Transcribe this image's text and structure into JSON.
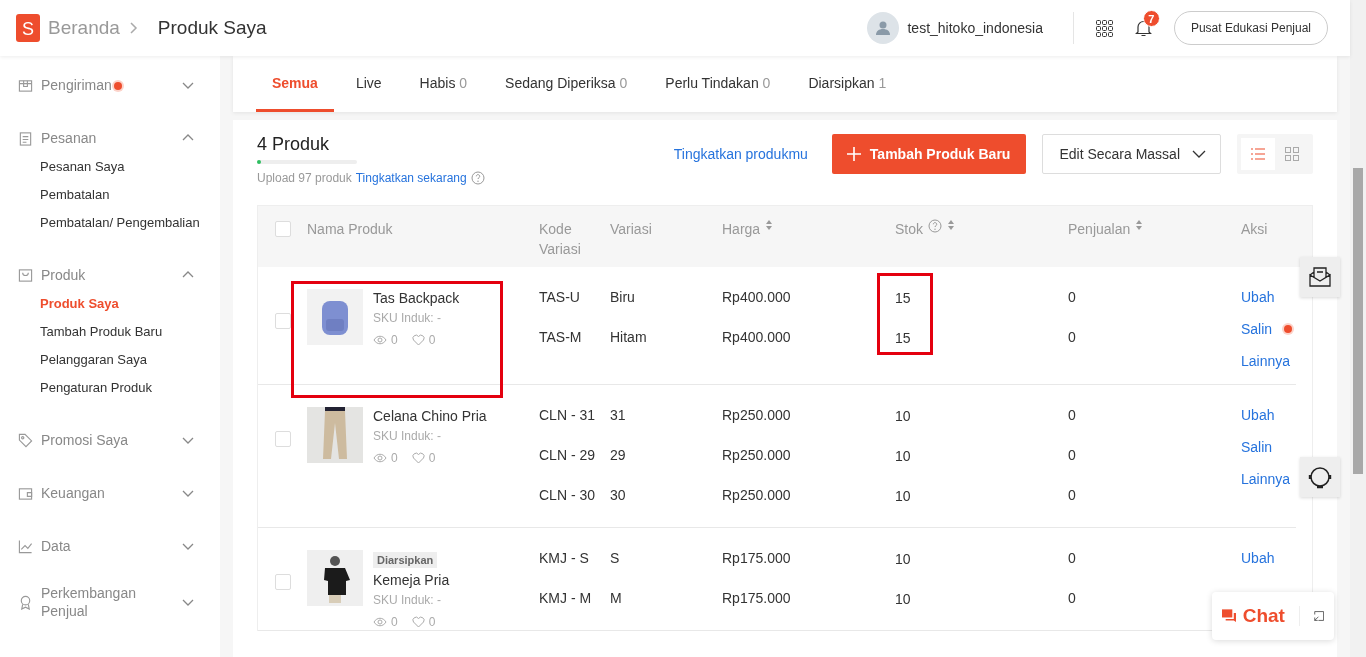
{
  "header": {
    "logo_letter": "S",
    "breadcrumb": [
      "Beranda",
      "Produk Saya"
    ],
    "username": "test_hitoko_indonesia",
    "notification_count": "7",
    "edu_button": "Pusat Edukasi Penjual"
  },
  "sidebar": {
    "items": [
      {
        "label": "Pengiriman",
        "dot": true,
        "expanded": false
      },
      {
        "label": "Pesanan",
        "expanded": true,
        "children": [
          {
            "label": "Pesanan Saya",
            "selected": false
          },
          {
            "label": "Pembatalan",
            "selected": false
          },
          {
            "label": "Pembatalan/ Pengembalian",
            "selected": false
          }
        ]
      },
      {
        "label": "Produk",
        "expanded": true,
        "children": [
          {
            "label": "Produk Saya",
            "selected": true
          },
          {
            "label": "Tambah Produk Baru",
            "selected": false
          },
          {
            "label": "Pelanggaran Saya",
            "selected": false
          },
          {
            "label": "Pengaturan Produk",
            "selected": false
          }
        ]
      },
      {
        "label": "Promosi Saya",
        "expanded": false
      },
      {
        "label": "Keuangan",
        "expanded": false
      },
      {
        "label": "Data",
        "expanded": false
      },
      {
        "label": "Perkembangan Penjual",
        "expanded": false
      }
    ]
  },
  "tabs": [
    {
      "label": "Semua",
      "selected": true
    },
    {
      "label": "Live",
      "selected": false
    },
    {
      "label": "Habis",
      "count": "0",
      "selected": false
    },
    {
      "label": "Sedang Diperiksa",
      "count": "0",
      "selected": false
    },
    {
      "label": "Perlu Tindakan",
      "count": "0",
      "selected": false
    },
    {
      "label": "Diarsipkan",
      "count": "1",
      "selected": false
    }
  ],
  "summary": {
    "title": "4 Produk",
    "level": 0.04,
    "upload_text": "Upload 97 produk",
    "upgrade_link": "Tingkatkan sekarang",
    "improve_link": "Tingkatkan produkmu",
    "add_button": "Tambah Produk Baru",
    "bulk_button": "Edit Secara Massal",
    "list_view_selected": true
  },
  "table": {
    "all_checked": false,
    "columns": [
      {
        "label": "Nama Produk"
      },
      {
        "label": "Kode Variasi"
      },
      {
        "label": "Variasi"
      },
      {
        "label": "Harga",
        "sortable": true
      },
      {
        "label": "Stok",
        "sortable": true,
        "help": true
      },
      {
        "label": "Penjualan",
        "sortable": true
      },
      {
        "label": "Aksi"
      }
    ],
    "rows": [
      {
        "name": "Tas Backpack",
        "sku": "SKU Induk: -",
        "views": "0",
        "likes": "0",
        "highlighted": true,
        "stock_highlighted": true,
        "checked": false,
        "variants": [
          {
            "code": "TAS-U",
            "variation": "Biru",
            "price": "Rp400.000",
            "stock": "15",
            "sales": "0"
          },
          {
            "code": "TAS-M",
            "variation": "Hitam",
            "price": "Rp400.000",
            "stock": "15",
            "sales": "0"
          }
        ],
        "actions": [
          {
            "label": "Ubah"
          },
          {
            "label": "Salin",
            "dot": true
          },
          {
            "label": "Lainnya"
          }
        ]
      },
      {
        "name": "Celana Chino Pria",
        "sku": "SKU Induk: -",
        "views": "0",
        "likes": "0",
        "checked": false,
        "variants": [
          {
            "code": "CLN - 31",
            "variation": "31",
            "price": "Rp250.000",
            "stock": "10",
            "sales": "0"
          },
          {
            "code": "CLN - 29",
            "variation": "29",
            "price": "Rp250.000",
            "stock": "10",
            "sales": "0"
          },
          {
            "code": "CLN - 30",
            "variation": "30",
            "price": "Rp250.000",
            "stock": "10",
            "sales": "0"
          }
        ],
        "actions": [
          {
            "label": "Ubah"
          },
          {
            "label": "Salin"
          },
          {
            "label": "Lainnya"
          }
        ]
      },
      {
        "name": "Kemeja Pria",
        "badge": "Diarsipkan",
        "sku": "SKU Induk: -",
        "views": "0",
        "likes": "0",
        "checked": false,
        "variants": [
          {
            "code": "KMJ - S",
            "variation": "S",
            "price": "Rp175.000",
            "stock": "10",
            "sales": "0"
          },
          {
            "code": "KMJ - M",
            "variation": "M",
            "price": "Rp175.000",
            "stock": "10",
            "sales": "0"
          }
        ],
        "actions": [
          {
            "label": "Ubah"
          }
        ]
      }
    ]
  },
  "chat": {
    "label": "Chat"
  }
}
